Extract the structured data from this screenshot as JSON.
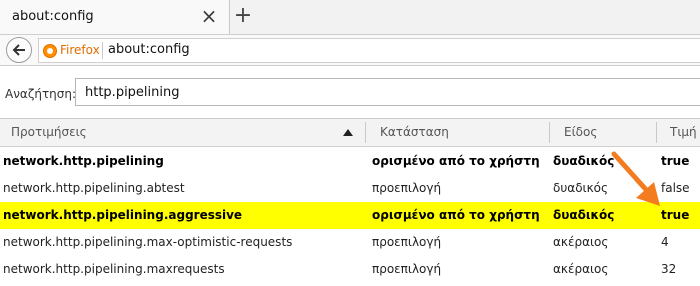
{
  "tab": {
    "title": "about:config",
    "close": "×",
    "new_tab": "+"
  },
  "navbar": {
    "identity": "Firefox",
    "url": "about:config"
  },
  "search": {
    "label": "Αναζήτηση:",
    "value": "http.pipelining"
  },
  "table": {
    "headers": {
      "name": "Προτιμήσεις",
      "status": "Κατάσταση",
      "type": "Είδος",
      "value": "Τιμή"
    },
    "rows": [
      {
        "name": "network.http.pipelining",
        "status": "ορισμένο από το χρήστη",
        "type": "δυαδικός",
        "value": "true"
      },
      {
        "name": "network.http.pipelining.abtest",
        "status": "προεπιλογή",
        "type": "δυαδικός",
        "value": "false"
      },
      {
        "name": "network.http.pipelining.aggressive",
        "status": "ορισμένο από το χρήστη",
        "type": "δυαδικός",
        "value": "true"
      },
      {
        "name": "network.http.pipelining.max-optimistic-requests",
        "status": "προεπιλογή",
        "type": "ακέραιος",
        "value": "4"
      },
      {
        "name": "network.http.pipelining.maxrequests",
        "status": "προεπιλογή",
        "type": "ακέραιος",
        "value": "32"
      }
    ]
  },
  "colors": {
    "highlight": "#ffff00",
    "annotation_arrow": "#f47c20",
    "firefox_orange": "#e26d00"
  }
}
